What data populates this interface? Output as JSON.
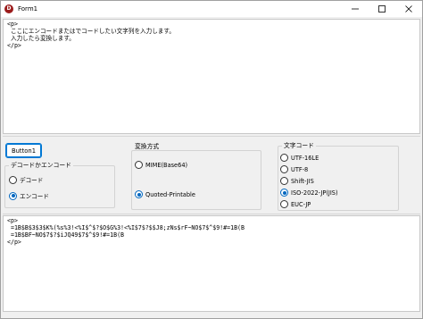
{
  "window": {
    "title": "Form1",
    "app_icon_letter": "D",
    "minimize_icon": "minimize-icon",
    "maximize_icon": "maximize-icon",
    "close_icon": "close-icon"
  },
  "input_memo": {
    "lines": [
      "<p>",
      " ここにエンコードまたはでコードしたい文字列を入力します。",
      " 入力したら変換します。",
      "</p>"
    ]
  },
  "button1": {
    "label": "Button1"
  },
  "decode_encode_group": {
    "caption": "デコードかエンコード",
    "options": [
      {
        "label": "デコード",
        "checked": false
      },
      {
        "label": "エンコード",
        "checked": true
      }
    ]
  },
  "conversion_method_group": {
    "caption": "変換方式",
    "options": [
      {
        "label": "MIME(Base64)",
        "checked": false
      },
      {
        "label": "Quoted-Printable",
        "checked": true
      }
    ]
  },
  "charset_group": {
    "caption": "文字コード",
    "options": [
      {
        "label": "UTF-16LE",
        "checked": false
      },
      {
        "label": "UTF-8",
        "checked": false
      },
      {
        "label": "Shift-JIS",
        "checked": false
      },
      {
        "label": "ISO-2022-JP(JIS)",
        "checked": true
      },
      {
        "label": "EUC-JP",
        "checked": false
      }
    ]
  },
  "output_memo": {
    "lines": [
      "<p>",
      " =1B$B$3$3$K%(%s%3!<%I$^$?$O$G%3!<%I$7$?$$J8;zNs$rF~NO$7$^$9!#=1B(B",
      " =1B$BF~NO$7$?$iJQ49$7$^$9!#=1B(B",
      "</p>"
    ]
  }
}
